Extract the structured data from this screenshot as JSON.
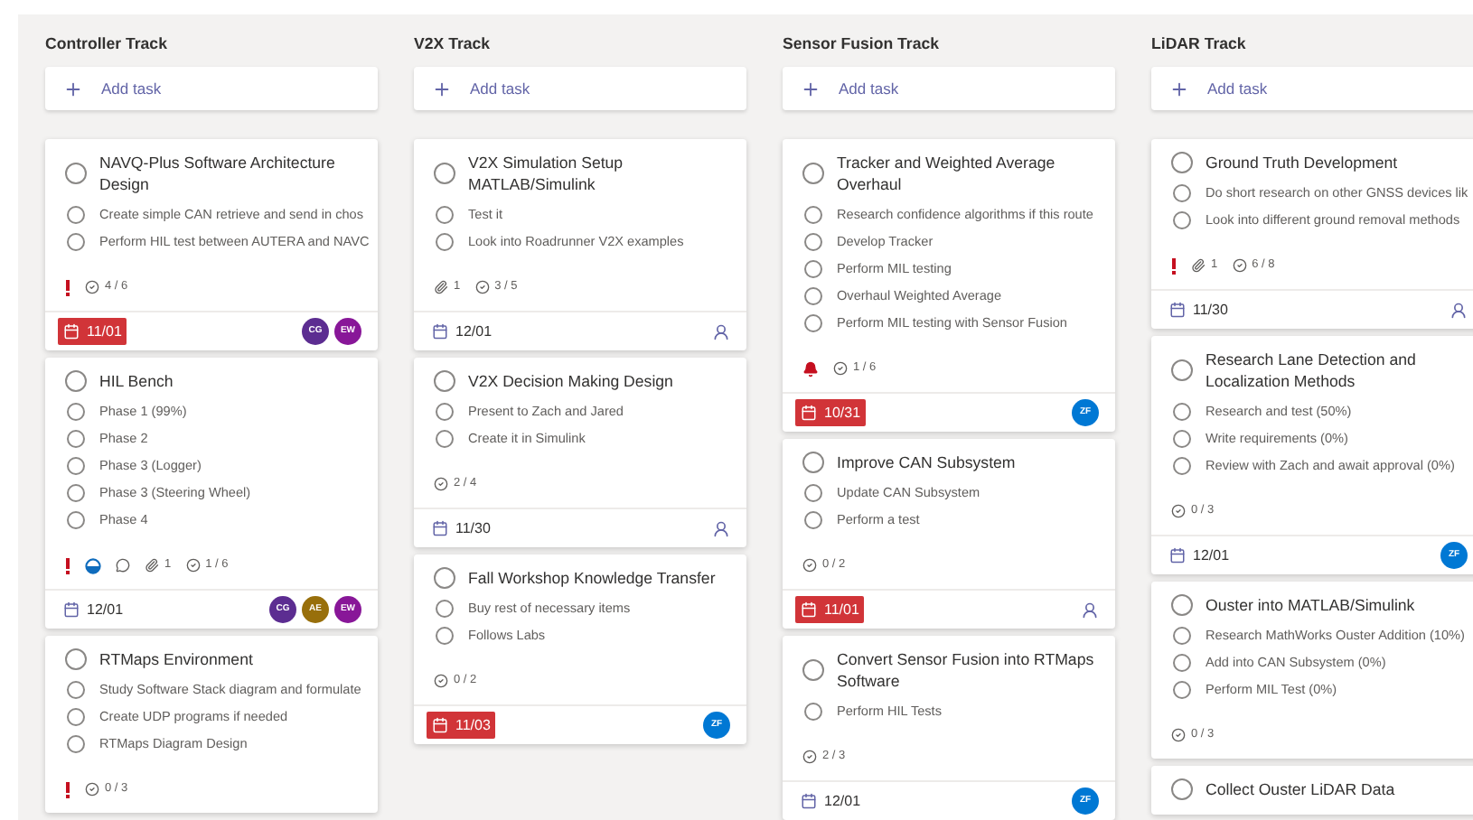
{
  "columns": [
    {
      "name": "Controller Track",
      "add_label": "Add task",
      "tasks": [
        {
          "title": "NAVQ-Plus Software Architecture Design",
          "completed": false,
          "checklist": [
            {
              "text": "Create simple CAN retrieve and send in chos",
              "checked": false
            },
            {
              "text": "Perform HIL test between AUTERA and NAVC",
              "checked": false
            }
          ],
          "important": true,
          "urgent": false,
          "in_progress": false,
          "comments": false,
          "checklist_count": "4 / 6",
          "due": {
            "date": "11/01",
            "overdue": true
          },
          "assignees": [
            {
              "initials": "CG",
              "color": "#5c2d91"
            },
            {
              "initials": "EW",
              "color": "#881798"
            }
          ]
        },
        {
          "title": "HIL Bench",
          "completed": false,
          "checklist": [
            {
              "text": "Phase 1 (99%)",
              "checked": false
            },
            {
              "text": "Phase 2",
              "checked": false
            },
            {
              "text": "Phase 3 (Logger)",
              "checked": false
            },
            {
              "text": "Phase 3 (Steering Wheel)",
              "checked": false
            },
            {
              "text": "Phase 4",
              "checked": false
            }
          ],
          "important": true,
          "urgent": false,
          "in_progress": true,
          "comments": true,
          "attachments": "1",
          "checklist_count": "1 / 6",
          "due": {
            "date": "12/01",
            "overdue": false
          },
          "assignees": [
            {
              "initials": "CG",
              "color": "#5c2d91"
            },
            {
              "initials": "AE",
              "color": "#986f0b"
            },
            {
              "initials": "EW",
              "color": "#881798"
            }
          ]
        },
        {
          "title": "RTMaps Environment",
          "completed": false,
          "checklist": [
            {
              "text": "Study Software Stack diagram and formulate",
              "checked": false
            },
            {
              "text": "Create UDP programs if needed",
              "checked": false
            },
            {
              "text": "RTMaps Diagram Design",
              "checked": false
            }
          ],
          "important": true,
          "urgent": false,
          "in_progress": false,
          "comments": false,
          "checklist_count": "0 / 3"
        }
      ]
    },
    {
      "name": "V2X Track",
      "add_label": "Add task",
      "tasks": [
        {
          "title": "V2X Simulation Setup MATLAB/Simulink",
          "completed": false,
          "checklist": [
            {
              "text": "Test it",
              "checked": false
            },
            {
              "text": "Look into Roadrunner V2X examples",
              "checked": false
            }
          ],
          "important": false,
          "urgent": false,
          "in_progress": false,
          "comments": false,
          "attachments": "1",
          "checklist_count": "3 / 5",
          "due": {
            "date": "12/01",
            "overdue": false
          },
          "unassigned": true
        },
        {
          "title": "V2X Decision Making Design",
          "completed": false,
          "checklist": [
            {
              "text": "Present to Zach and Jared",
              "checked": false
            },
            {
              "text": "Create it in Simulink",
              "checked": false
            }
          ],
          "important": false,
          "urgent": false,
          "in_progress": false,
          "comments": false,
          "checklist_count": "2 / 4",
          "due": {
            "date": "11/30",
            "overdue": false
          },
          "unassigned": true
        },
        {
          "title": "Fall Workshop Knowledge Transfer",
          "completed": false,
          "checklist": [
            {
              "text": "Buy rest of necessary items",
              "checked": false
            },
            {
              "text": "Follows Labs",
              "checked": false
            }
          ],
          "important": false,
          "urgent": false,
          "in_progress": false,
          "comments": false,
          "checklist_count": "0 / 2",
          "due": {
            "date": "11/03",
            "overdue": true
          },
          "assignees": [
            {
              "initials": "ZF",
              "color": "#0078d4"
            }
          ]
        }
      ]
    },
    {
      "name": "Sensor Fusion Track",
      "add_label": "Add task",
      "tasks": [
        {
          "title": "Tracker and Weighted Average Overhaul",
          "completed": false,
          "checklist": [
            {
              "text": "Research confidence algorithms if this route",
              "checked": false
            },
            {
              "text": "Develop Tracker",
              "checked": false
            },
            {
              "text": "Perform MIL testing",
              "checked": false
            },
            {
              "text": "Overhaul Weighted Average",
              "checked": false
            },
            {
              "text": "Perform MIL testing with Sensor Fusion",
              "checked": false
            }
          ],
          "important": false,
          "urgent": true,
          "in_progress": false,
          "comments": false,
          "checklist_count": "1 / 6",
          "due": {
            "date": "10/31",
            "overdue": true
          },
          "assignees": [
            {
              "initials": "ZF",
              "color": "#0078d4"
            }
          ]
        },
        {
          "title": "Improve CAN Subsystem",
          "completed": false,
          "checklist": [
            {
              "text": "Update CAN Subsystem",
              "checked": false
            },
            {
              "text": "Perform a test",
              "checked": false
            }
          ],
          "important": false,
          "urgent": false,
          "in_progress": false,
          "comments": false,
          "checklist_count": "0 / 2",
          "due": {
            "date": "11/01",
            "overdue": true
          },
          "unassigned": true
        },
        {
          "title": "Convert Sensor Fusion into RTMaps Software",
          "completed": false,
          "checklist": [
            {
              "text": "Perform HIL Tests",
              "checked": false
            }
          ],
          "important": false,
          "urgent": false,
          "in_progress": false,
          "comments": false,
          "checklist_count": "2 / 3",
          "due": {
            "date": "12/01",
            "overdue": false
          },
          "assignees": [
            {
              "initials": "ZF",
              "color": "#0078d4"
            }
          ]
        }
      ]
    },
    {
      "name": "LiDAR Track",
      "add_label": "Add task",
      "tasks": [
        {
          "title": "Ground Truth Development",
          "completed": false,
          "checklist": [
            {
              "text": "Do short research on other GNSS devices lik",
              "checked": false
            },
            {
              "text": "Look into different ground removal methods",
              "checked": false
            }
          ],
          "important": true,
          "urgent": false,
          "in_progress": false,
          "comments": false,
          "attachments": "1",
          "checklist_count": "6 / 8",
          "due": {
            "date": "11/30",
            "overdue": false
          },
          "unassigned": true
        },
        {
          "title": "Research Lane Detection and Localization Methods",
          "completed": false,
          "checklist": [
            {
              "text": "Research and test (50%)",
              "checked": false
            },
            {
              "text": "Write requirements (0%)",
              "checked": false
            },
            {
              "text": "Review with Zach and await approval (0%)",
              "checked": false
            }
          ],
          "important": false,
          "urgent": false,
          "in_progress": false,
          "comments": false,
          "checklist_count": "0 / 3",
          "due": {
            "date": "12/01",
            "overdue": false
          },
          "assignees": [
            {
              "initials": "ZF",
              "color": "#0078d4"
            }
          ]
        },
        {
          "title": "Ouster into MATLAB/Simulink",
          "completed": false,
          "checklist": [
            {
              "text": "Research MathWorks Ouster Addition (10%)",
              "checked": false
            },
            {
              "text": "Add into CAN Subsystem (0%)",
              "checked": false
            },
            {
              "text": "Perform MIL Test (0%)",
              "checked": false
            }
          ],
          "important": false,
          "urgent": false,
          "in_progress": false,
          "comments": false,
          "checklist_count": "0 / 3"
        },
        {
          "title": "Collect Ouster LiDAR Data",
          "completed": false
        }
      ]
    }
  ]
}
